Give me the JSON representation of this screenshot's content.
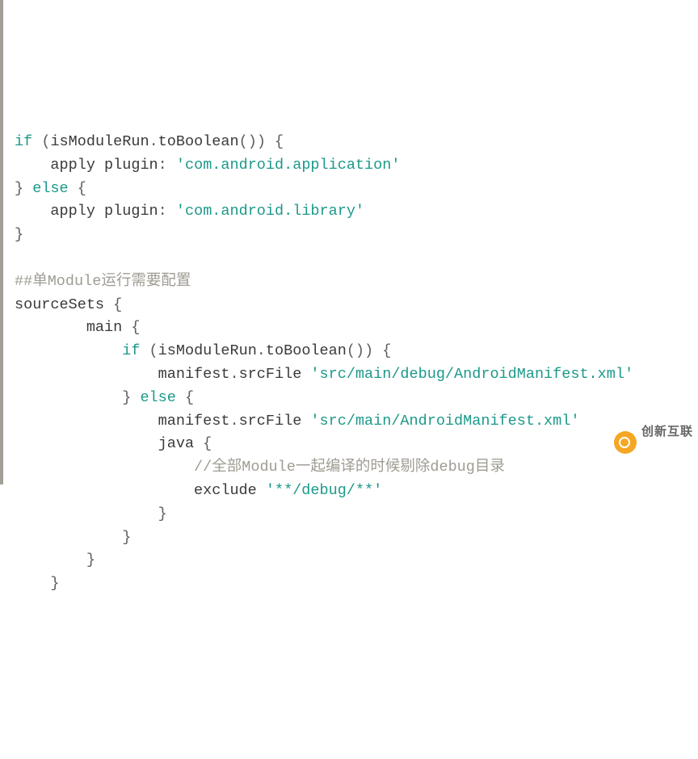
{
  "code": {
    "l1": {
      "kw": "if",
      "open": " (",
      "id1": "isModuleRun",
      "dot": ".",
      "id2": "toBoolean",
      "parens": "()",
      "close": ") {",
      "indent": ""
    },
    "l2": {
      "indent": "    ",
      "id1": "apply",
      "sp": " ",
      "id2": "plugin",
      "op": ": ",
      "str": "'com.android.application'"
    },
    "l3": {
      "indent": "",
      "close": "}",
      "sp": " ",
      "kw": "else",
      "open": " {"
    },
    "l4": {
      "indent": "    ",
      "id1": "apply",
      "sp": " ",
      "id2": "plugin",
      "op": ": ",
      "str": "'com.android.library'"
    },
    "l5": {
      "indent": "",
      "close": "}"
    },
    "blank1": "",
    "l6": {
      "indent": "",
      "comment": "##单Module运行需要配置"
    },
    "l7": {
      "indent": "",
      "id1": "sourceSets",
      "sp": " ",
      "open": "{"
    },
    "l8": {
      "indent": "        ",
      "id1": "main",
      "sp": " ",
      "open": "{"
    },
    "l9": {
      "indent": "            ",
      "kw": "if",
      "open": " (",
      "id1": "isModuleRun",
      "dot": ".",
      "id2": "toBoolean",
      "parens": "()",
      "close": ") {"
    },
    "l10": {
      "indent": "                ",
      "id1": "manifest",
      "dot": ".",
      "id2": "srcFile",
      "sp": " ",
      "str": "'src/main/debug/AndroidManifest.xml'"
    },
    "l11": {
      "indent": "            ",
      "close": "}",
      "sp": " ",
      "kw": "else",
      "open": " {"
    },
    "l12": {
      "indent": "                ",
      "id1": "manifest",
      "dot": ".",
      "id2": "srcFile",
      "sp": " ",
      "str": "'src/main/AndroidManifest.xml'"
    },
    "l13": {
      "indent": "                ",
      "id1": "java",
      "sp": " ",
      "open": "{"
    },
    "l14": {
      "indent": "                    ",
      "comment": "//全部Module一起编译的时候剔除debug目录"
    },
    "l15": {
      "indent": "                    ",
      "id1": "exclude",
      "sp": " ",
      "str": "'**/debug/**'"
    },
    "l16": {
      "indent": "                ",
      "close": "}"
    },
    "l17": {
      "indent": "            ",
      "close": "}"
    },
    "l18": {
      "indent": "        ",
      "close": "}"
    },
    "l19": {
      "indent": "    ",
      "close": "}"
    }
  },
  "watermark": {
    "big": "创新互联",
    "small": ""
  }
}
